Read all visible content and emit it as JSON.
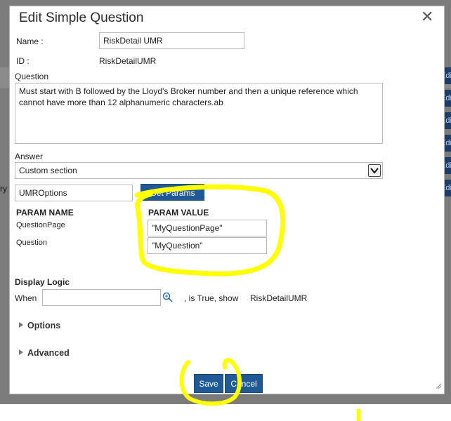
{
  "background": {
    "left_fragment": "ry",
    "edit_tab_label": "Edi",
    "edit_tab_count": 6
  },
  "dialog": {
    "title": "Edit Simple Question",
    "close_icon": "close-icon",
    "name": {
      "label": "Name :",
      "value": "RiskDetail UMR"
    },
    "id": {
      "label": "ID :",
      "value": "RiskDetailUMR"
    },
    "question": {
      "label": "Question",
      "value": "Must start with B followed by the Lloyd's Broker number and then a unique reference which cannot have more than 12 alphanumeric characters.ab"
    },
    "answer": {
      "label": "Answer",
      "value": "Custom section",
      "dropdown_icon": "chevron-down-icon"
    },
    "options_source": {
      "value": "UMROptions"
    },
    "get_params_label": "Get Params",
    "params": {
      "name_header": "PARAM NAME",
      "value_header": "PARAM VALUE",
      "rows": [
        {
          "name": "QuestionPage",
          "value": "\"MyQuestionPage\""
        },
        {
          "name": "Question",
          "value": "\"MyQuestion\""
        }
      ]
    },
    "display_logic": {
      "label": "Display Logic",
      "when_label": "When",
      "when_value": "",
      "search_icon": "search-icon",
      "is_true_text": ", is True, show",
      "target": "RiskDetailUMR"
    },
    "sections": {
      "options": "Options",
      "advanced": "Advanced"
    },
    "buttons": {
      "save": "Save",
      "cancel": "Cancel"
    }
  },
  "colors": {
    "overlay": "#7b7b7b",
    "button_blue": "#1f5a96",
    "edit_tab": "#1d3d68",
    "highlight": "#ffff00"
  }
}
